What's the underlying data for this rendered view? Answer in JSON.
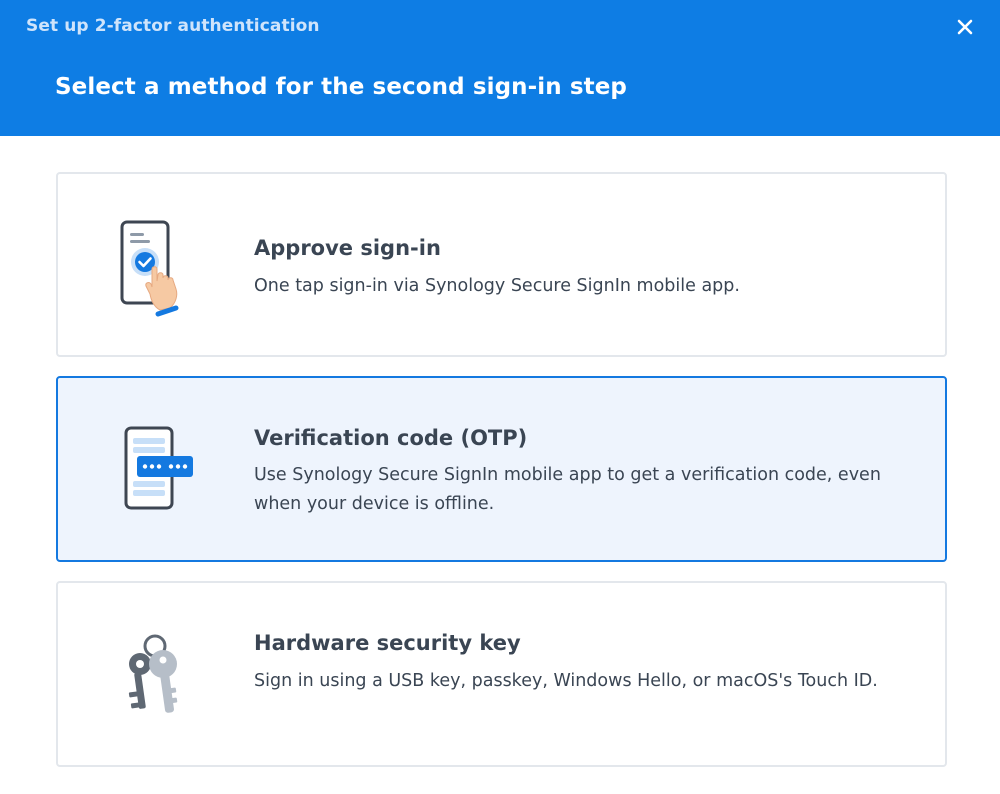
{
  "window": {
    "title": "Set up 2-factor authentication",
    "close_icon": "close-icon"
  },
  "header": {
    "heading": "Select a method for the second sign-in step",
    "background_color": "#0e7de4"
  },
  "methods": [
    {
      "id": "approve",
      "title": "Approve sign-in",
      "description": "One tap sign-in via Synology Secure SignIn mobile app.",
      "icon": "phone-tap-icon",
      "selected": false
    },
    {
      "id": "otp",
      "title": "Verification code (OTP)",
      "description": "Use Synology Secure SignIn mobile app to get a verification code, even when your device is offline.",
      "icon": "phone-code-icon",
      "selected": true
    },
    {
      "id": "key",
      "title": "Hardware security key",
      "description": "Sign in using a USB key, passkey, Windows Hello, or macOS's Touch ID.",
      "icon": "keys-icon",
      "selected": false
    }
  ],
  "colors": {
    "accent": "#1479e0",
    "selected_background": "#eef4fd",
    "text": "#3a4553"
  }
}
